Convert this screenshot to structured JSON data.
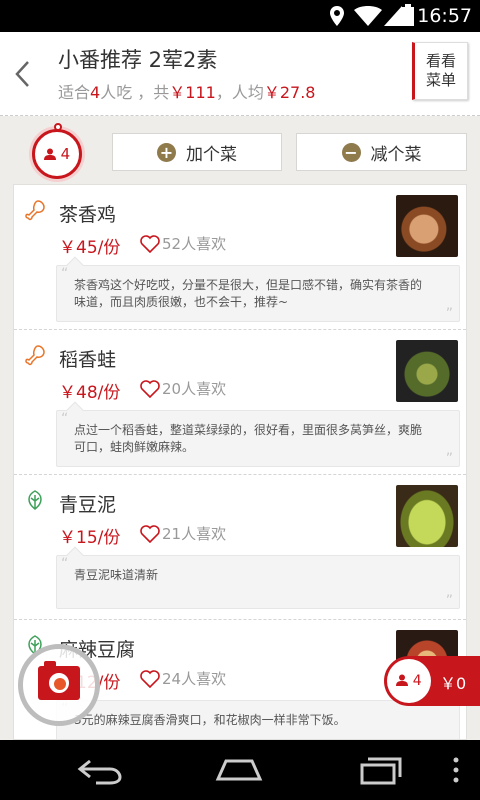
{
  "status_bar": {
    "time": "16:57"
  },
  "header": {
    "title": "小番推荐 2荤2素",
    "subtitle_prefix": "适合",
    "people": "4",
    "subtitle_mid": "人吃 ，共",
    "total": "￥111",
    "subtitle_avg_label": "，人均",
    "avg": "￥27.8",
    "menu_line1": "看看",
    "menu_line2": "菜单"
  },
  "toolbar": {
    "people_count": "4",
    "add_label": "加个菜",
    "remove_label": "减个菜",
    "add_symbol": "+",
    "remove_symbol": "−"
  },
  "dishes": [
    {
      "name": "茶香鸡",
      "type": "meat",
      "price": "￥45/份",
      "likes": "52人喜欢",
      "desc": "茶香鸡这个好吃哎，分量不是很大，但是口感不错，确实有茶香的味道，而且肉质很嫩，也不会干，推荐~"
    },
    {
      "name": "稻香蛙",
      "type": "meat",
      "price": "￥48/份",
      "likes": "20人喜欢",
      "desc": "点过一个稻香蛙，整道菜绿绿的，很好看，里面很多莴笋丝，爽脆可口，蛙肉鲜嫩麻辣。"
    },
    {
      "name": "青豆泥",
      "type": "veg",
      "price": "￥15/份",
      "likes": "21人喜欢",
      "desc": "青豆泥味道清新"
    },
    {
      "name": "麻辣豆腐",
      "type": "veg",
      "price": "￥12/份",
      "likes": "24人喜欢",
      "desc": "3元的麻辣豆腐香滑爽口，和花椒肉一样非常下饭。"
    }
  ],
  "cart": {
    "count": "4",
    "total": "￥0"
  },
  "colors": {
    "accent": "#c8161d",
    "button_icon": "#8f7a4c"
  }
}
